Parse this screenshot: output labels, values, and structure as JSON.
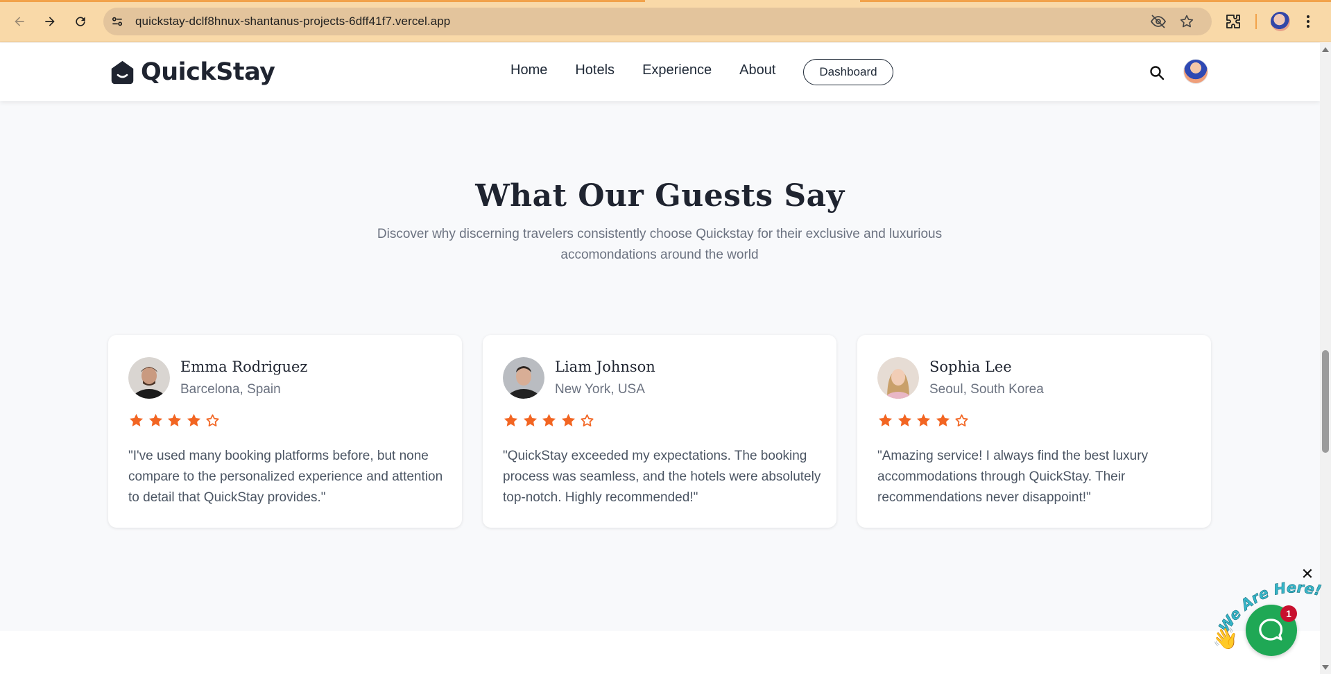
{
  "browser": {
    "url": "quickstay-dclf8hnux-shantanus-projects-6dff41f7.vercel.app",
    "icons": [
      "back-icon",
      "forward-icon",
      "reload-icon",
      "site-info-icon",
      "eye-off-icon",
      "star-bookmark-icon",
      "extensions-icon",
      "profile-avatar",
      "kebab-menu-icon"
    ]
  },
  "navbar": {
    "brand": "QuickStay",
    "links": [
      "Home",
      "Hotels",
      "Experience",
      "About"
    ],
    "dashboard_label": "Dashboard"
  },
  "section": {
    "title": "What Our Guests Say",
    "subtitle": "Discover why discerning travelers consistently choose Quickstay for their exclusive and luxurious accomondations around the world"
  },
  "testimonials": [
    {
      "name": "Emma Rodriguez",
      "location": "Barcelona, Spain",
      "rating": 4,
      "max_rating": 5,
      "quote": "\"I've used many booking platforms before, but none compare to the personalized experience and attention to detail that QuickStay provides.\""
    },
    {
      "name": "Liam Johnson",
      "location": "New York, USA",
      "rating": 4,
      "max_rating": 5,
      "quote": "\"QuickStay exceeded my expectations. The booking process was seamless, and the hotels were absolutely top-notch. Highly recommended!\""
    },
    {
      "name": "Sophia Lee",
      "location": "Seoul, South Korea",
      "rating": 4,
      "max_rating": 5,
      "quote": "\"Amazing service! I always find the best luxury accommodations through QuickStay. Their recommendations never disappoint!\""
    }
  ],
  "chat_widget": {
    "banner_text": "We Are Here!",
    "badge_count": "1",
    "close_glyph": "✕"
  },
  "colors": {
    "chrome_bg": "#f9d9a8",
    "star": "#f26522",
    "chat_green": "#1fa855",
    "badge_red": "#c8102e"
  }
}
